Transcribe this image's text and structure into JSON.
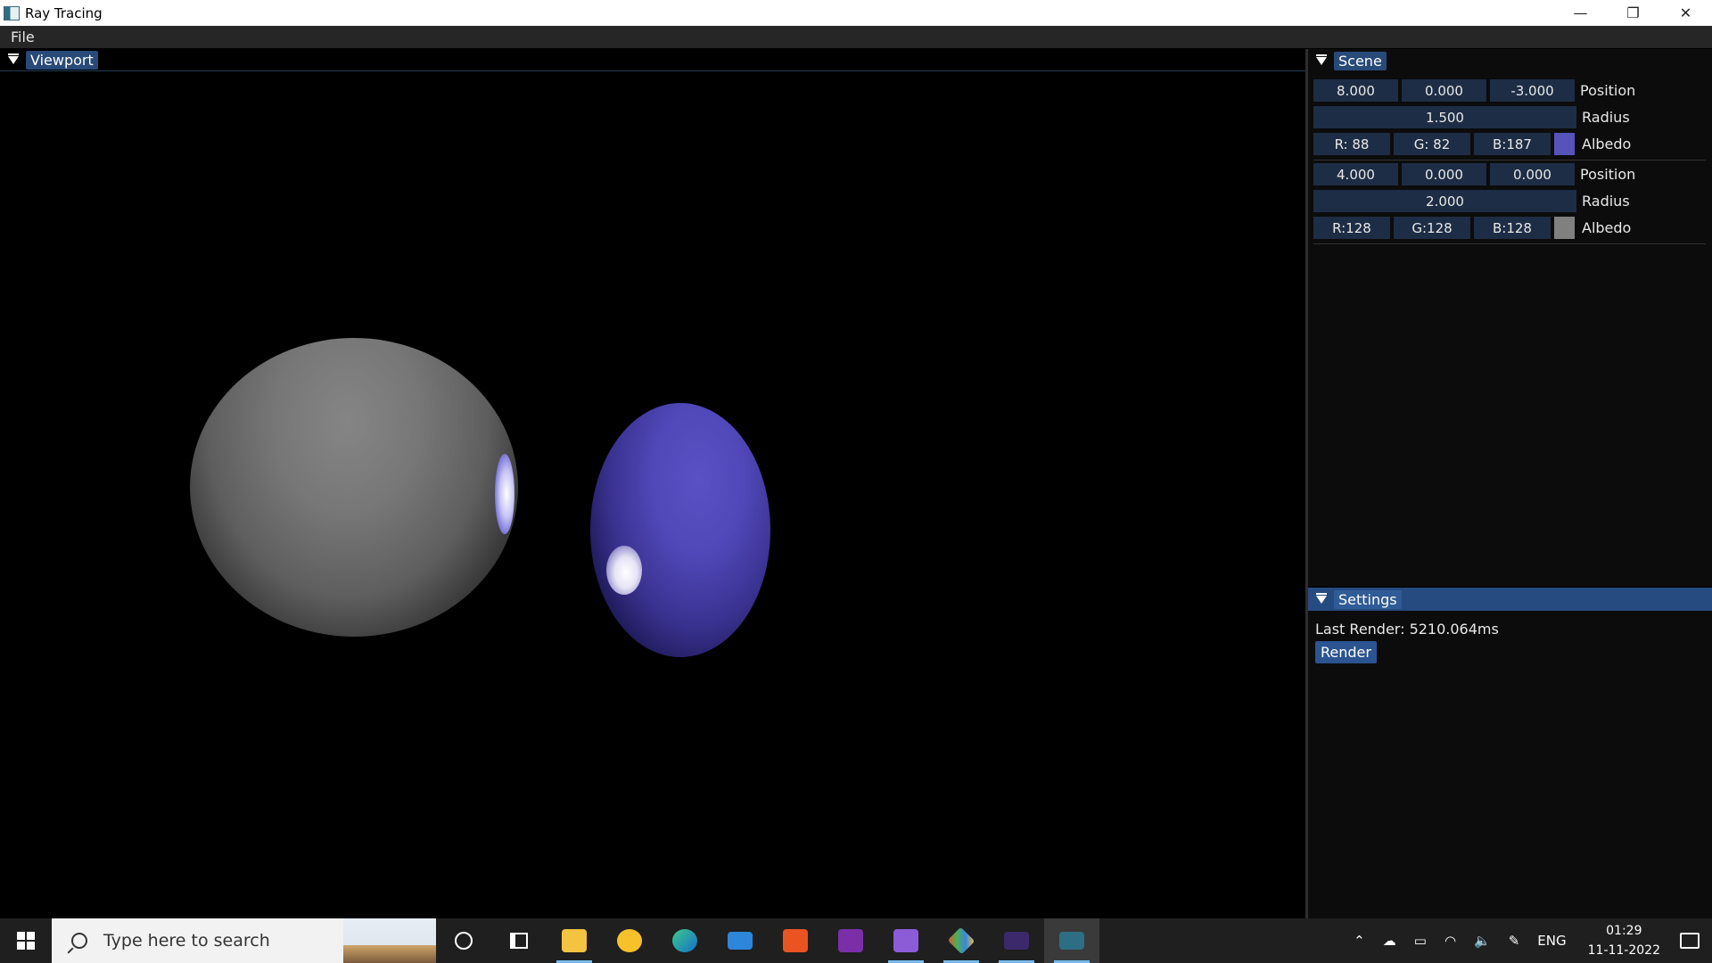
{
  "window": {
    "title": "Ray Tracing",
    "minimize_glyph": "—",
    "restore_glyph": "❐",
    "close_glyph": "✕"
  },
  "menu": {
    "file_label": "File"
  },
  "viewport": {
    "label": "Viewport"
  },
  "scene": {
    "label": "Scene",
    "spheres": [
      {
        "position": [
          "8.000",
          "0.000",
          "-3.000"
        ],
        "position_label": "Position",
        "radius": "1.500",
        "radius_label": "Radius",
        "albedo": [
          "R: 88",
          "G: 82",
          "B:187"
        ],
        "albedo_color": "#5852bb",
        "albedo_label": "Albedo"
      },
      {
        "position": [
          "4.000",
          "0.000",
          "0.000"
        ],
        "position_label": "Position",
        "radius": "2.000",
        "radius_label": "Radius",
        "albedo": [
          "R:128",
          "G:128",
          "B:128"
        ],
        "albedo_color": "#808080",
        "albedo_label": "Albedo"
      }
    ]
  },
  "settings": {
    "label": "Settings",
    "last_render": "Last Render: 5210.064ms",
    "render_button": "Render"
  },
  "taskbar": {
    "search_placeholder": "Type here to search",
    "tray_lang": "ENG",
    "time": "01:29",
    "date": "11-11-2022",
    "icons": [
      "task-view-cortana",
      "task-view",
      "file-explorer",
      "sticky-app",
      "edge",
      "mail",
      "ubuntu",
      "onenote",
      "visual-studio",
      "git",
      "terminal",
      "ray-tracing-app"
    ]
  },
  "colors": {
    "accent": "#284a78",
    "field_bg": "#1d2d45"
  }
}
